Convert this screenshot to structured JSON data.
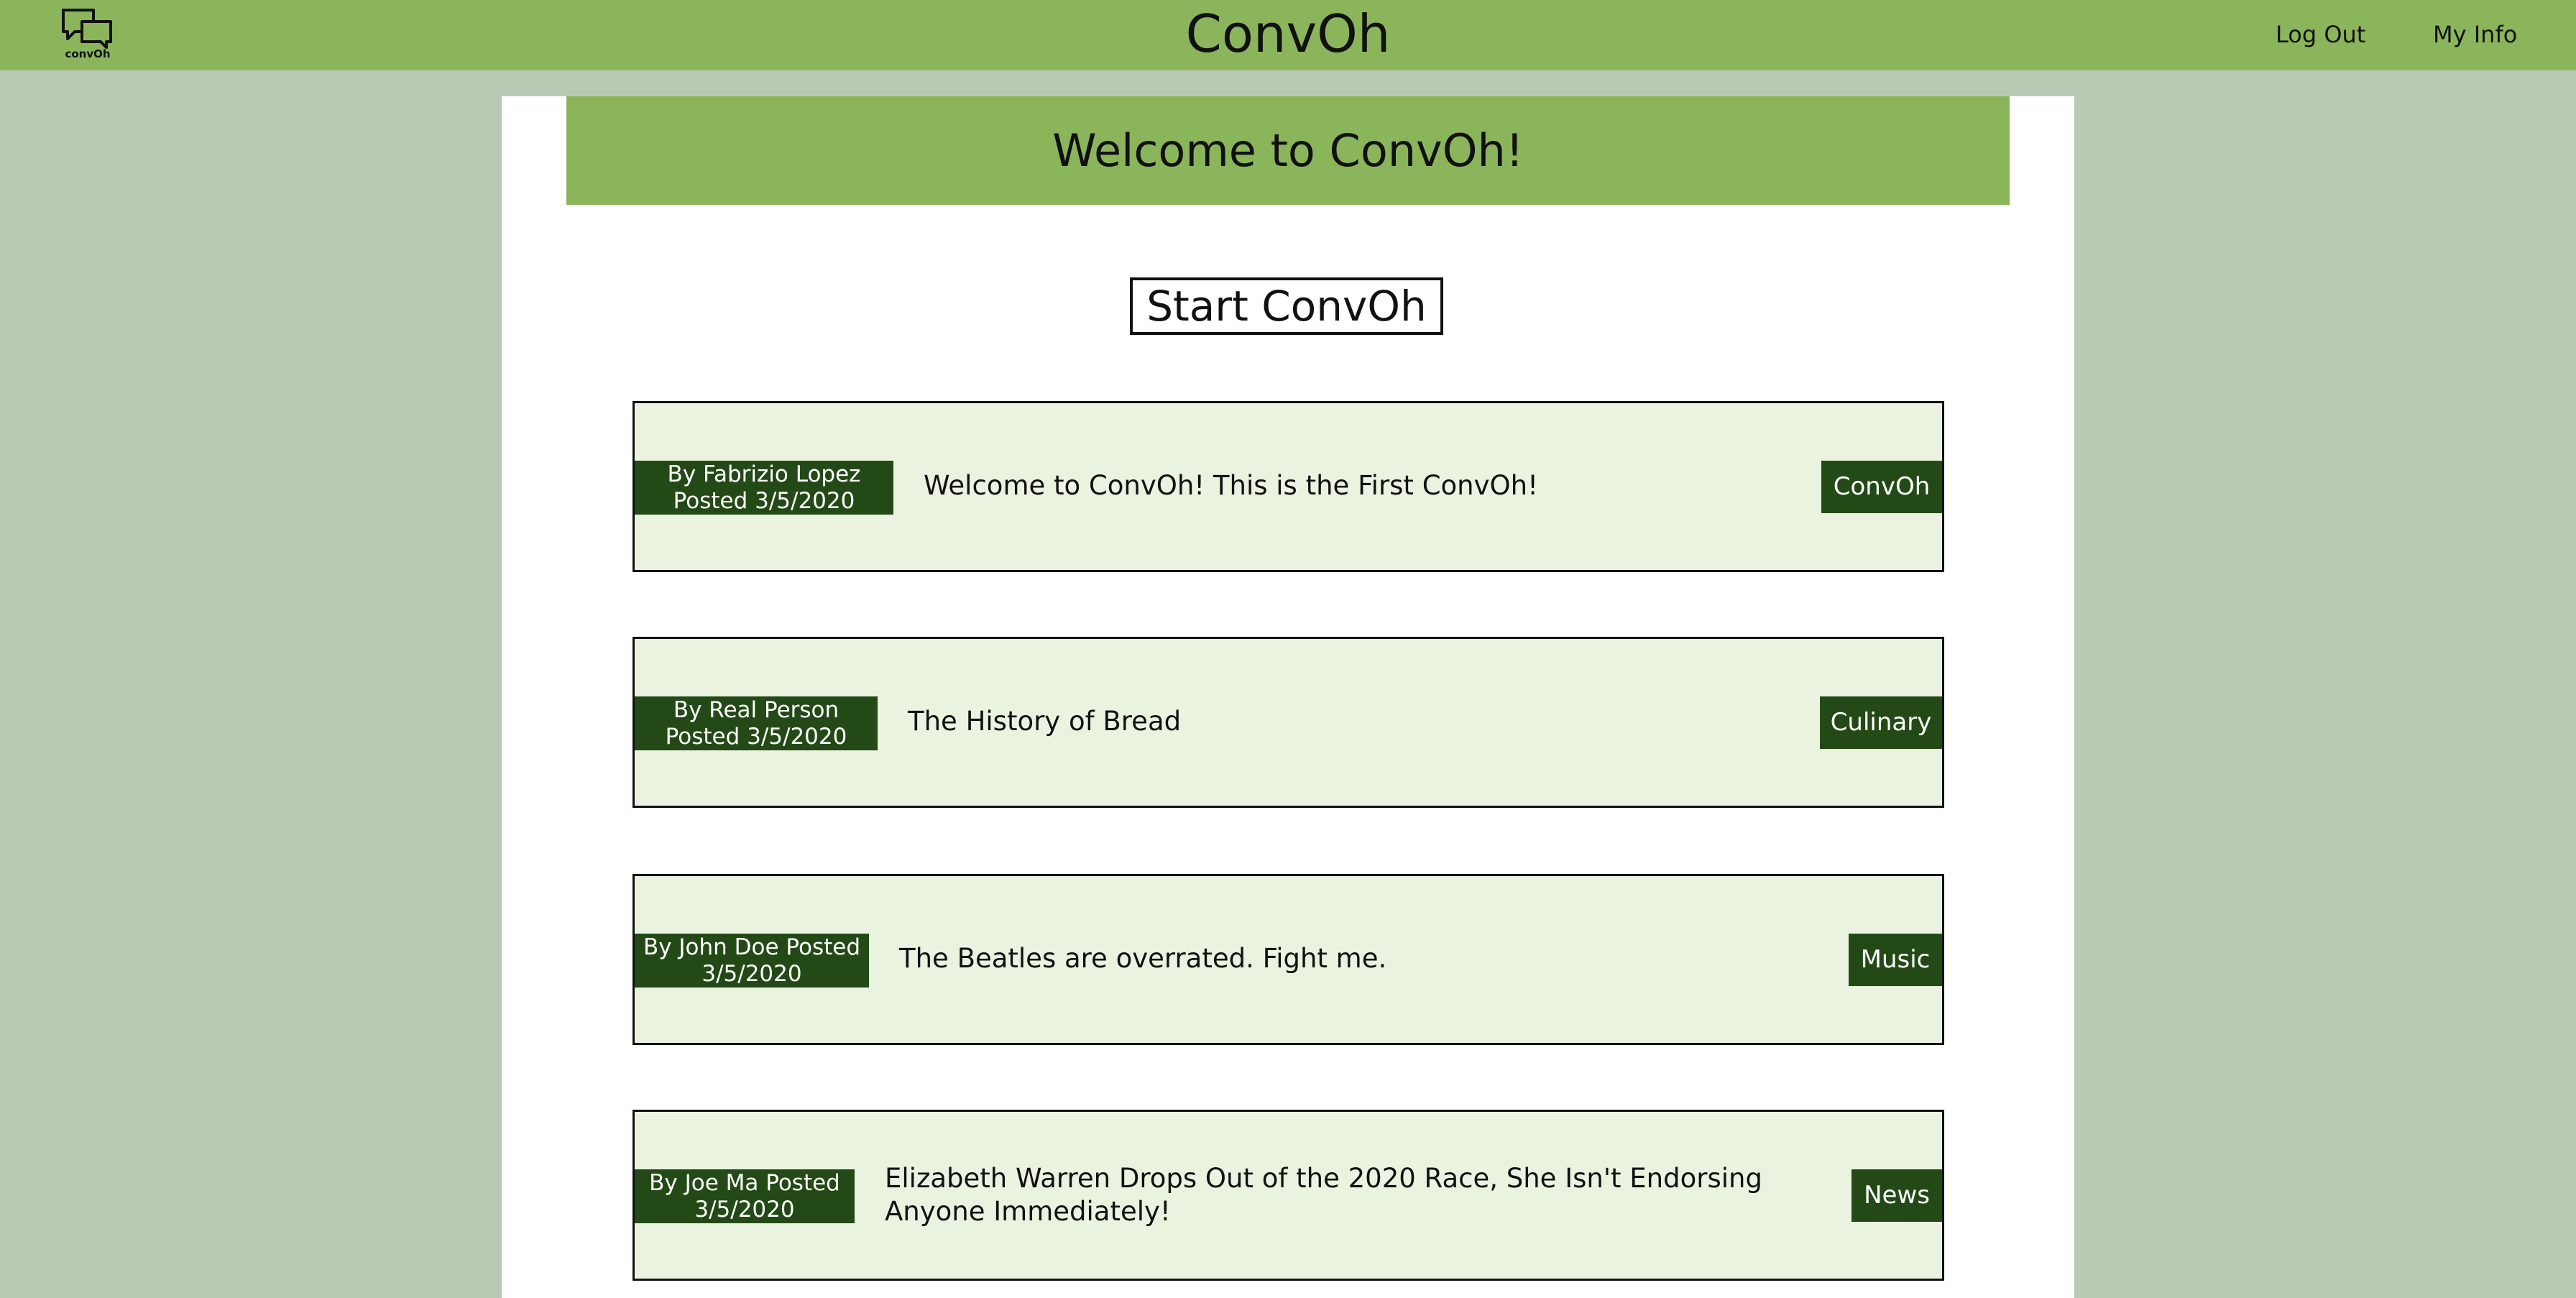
{
  "navbar": {
    "logo_text": "convOh",
    "brand": "ConvOh",
    "logout_label": "Log Out",
    "myinfo_label": "My Info"
  },
  "main": {
    "welcome_text": "Welcome to ConvOh!",
    "start_button_label": "Start ConvOh"
  },
  "convos": [
    {
      "author_line1": "By Fabrizio Lopez",
      "author_line2": "Posted 3/5/2020",
      "title": "Welcome to ConvOh! This is the First ConvOh!",
      "tag": "ConvOh"
    },
    {
      "author_line1": "By Real Person",
      "author_line2": "Posted 3/5/2020",
      "title": "The History of Bread",
      "tag": "Culinary"
    },
    {
      "author_line1": "By John Doe Posted",
      "author_line2": "3/5/2020",
      "title": "The Beatles are overrated. Fight me.",
      "tag": "Music"
    },
    {
      "author_line1": "By Joe Ma Posted",
      "author_line2": "3/5/2020",
      "title_line1": "Elizabeth Warren Drops Out of the 2020 Race, She Isn't Endorsing",
      "title_line2": "Anyone Immediately!",
      "tag": "News"
    }
  ],
  "colors": {
    "navbar": "#8bb55a",
    "background": "#b9cab4",
    "card": "#eaf3e0",
    "badge": "#234a16"
  }
}
